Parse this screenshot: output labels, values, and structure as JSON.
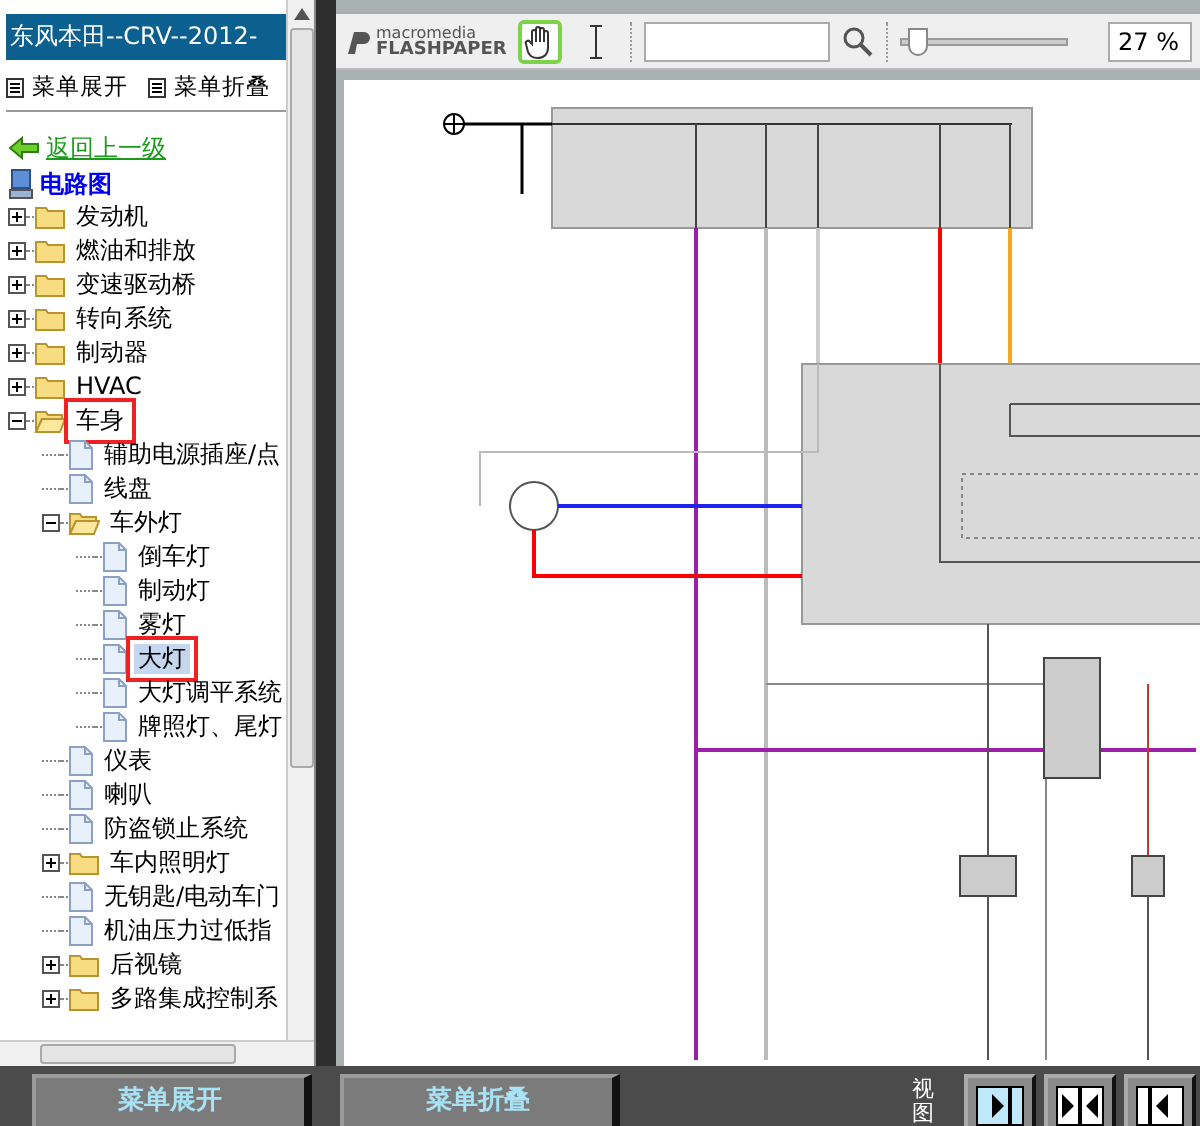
{
  "sidebar": {
    "title": "东风本田--CRV--2012-",
    "menu": [
      {
        "label": "菜单展开"
      },
      {
        "label": "菜单折叠"
      }
    ],
    "back_link": "返回上一级",
    "tree": {
      "label": "电路图",
      "children": [
        {
          "label": "发动机",
          "kind": "folder",
          "expanded": false,
          "selected": false,
          "annotated": false
        },
        {
          "label": "燃油和排放",
          "kind": "folder",
          "expanded": false,
          "selected": false,
          "annotated": false
        },
        {
          "label": "变速驱动桥",
          "kind": "folder",
          "expanded": false,
          "selected": false,
          "annotated": false
        },
        {
          "label": "转向系统",
          "kind": "folder",
          "expanded": false,
          "selected": false,
          "annotated": false
        },
        {
          "label": "制动器",
          "kind": "folder",
          "expanded": false,
          "selected": false,
          "annotated": false
        },
        {
          "label": "HVAC",
          "kind": "folder",
          "expanded": false,
          "selected": false,
          "annotated": false
        },
        {
          "label": "车身",
          "kind": "folder",
          "expanded": true,
          "selected": false,
          "annotated": true,
          "children": [
            {
              "label": "辅助电源插座/点",
              "kind": "doc",
              "selected": false,
              "annotated": false
            },
            {
              "label": "线盘",
              "kind": "doc",
              "selected": false,
              "annotated": false
            },
            {
              "label": "车外灯",
              "kind": "folder",
              "expanded": true,
              "selected": false,
              "annotated": false,
              "children": [
                {
                  "label": "倒车灯",
                  "kind": "doc",
                  "selected": false,
                  "annotated": false
                },
                {
                  "label": "制动灯",
                  "kind": "doc",
                  "selected": false,
                  "annotated": false
                },
                {
                  "label": "雾灯",
                  "kind": "doc",
                  "selected": false,
                  "annotated": false
                },
                {
                  "label": "大灯",
                  "kind": "doc",
                  "selected": true,
                  "annotated": true
                },
                {
                  "label": "大灯调平系统",
                  "kind": "doc",
                  "selected": false,
                  "annotated": false
                },
                {
                  "label": "牌照灯、尾灯",
                  "kind": "doc",
                  "selected": false,
                  "annotated": false
                }
              ]
            },
            {
              "label": "仪表",
              "kind": "doc",
              "selected": false,
              "annotated": false
            },
            {
              "label": "喇叭",
              "kind": "doc",
              "selected": false,
              "annotated": false
            },
            {
              "label": "防盗锁止系统",
              "kind": "doc",
              "selected": false,
              "annotated": false
            },
            {
              "label": "车内照明灯",
              "kind": "folder",
              "expanded": false,
              "selected": false,
              "annotated": false
            },
            {
              "label": "无钥匙/电动车门",
              "kind": "doc",
              "selected": false,
              "annotated": false
            },
            {
              "label": "机油压力过低指",
              "kind": "doc",
              "selected": false,
              "annotated": false
            },
            {
              "label": "后视镜",
              "kind": "folder",
              "expanded": false,
              "selected": false,
              "annotated": false
            },
            {
              "label": "多路集成控制系",
              "kind": "folder",
              "expanded": false,
              "selected": false,
              "annotated": false
            }
          ]
        }
      ]
    }
  },
  "viewer": {
    "logo_top": "macromedia",
    "logo_bottom": "FLASHPAPER",
    "tools": [
      {
        "kind": "hand",
        "selected": true
      },
      {
        "kind": "text_select",
        "selected": false
      }
    ],
    "zoom_slider": {
      "level": 0.05
    },
    "zoom": "27 %"
  },
  "bottom_bar": {
    "buttons": [
      {
        "label": "菜单展开"
      },
      {
        "label": "菜单折叠"
      }
    ],
    "view_label": "视图",
    "view_buttons": [
      {
        "kind": "right",
        "selected": true
      },
      {
        "kind": "both",
        "selected": false
      },
      {
        "kind": "left",
        "selected": false
      }
    ]
  }
}
